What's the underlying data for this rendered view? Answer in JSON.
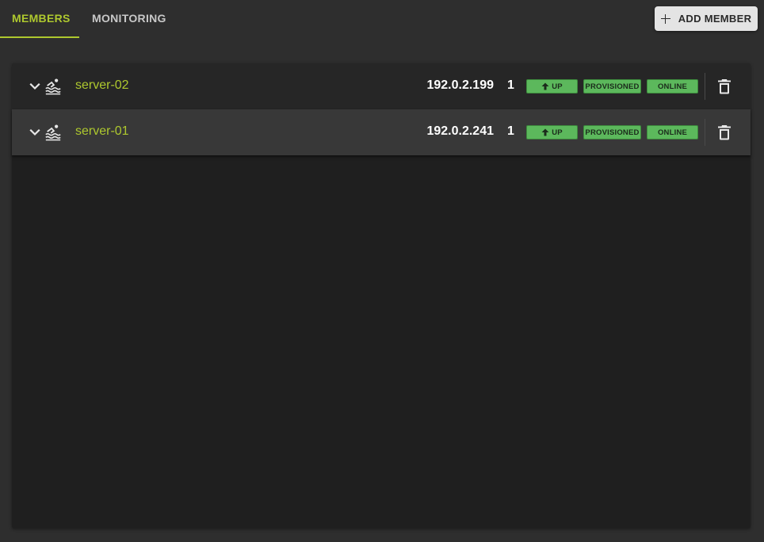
{
  "tabs": [
    {
      "label": "MEMBERS",
      "active": true
    },
    {
      "label": "MONITORING",
      "active": false
    }
  ],
  "add_button": {
    "label": "ADD MEMBER",
    "icon": "plus-icon"
  },
  "members": [
    {
      "name": "server-02",
      "ip": "192.0.2.199",
      "count": "1",
      "status_up": "UP",
      "status_provisioned": "PROVISIONED",
      "status_online": "ONLINE"
    },
    {
      "name": "server-01",
      "ip": "192.0.2.241",
      "count": "1",
      "status_up": "UP",
      "status_provisioned": "PROVISIONED",
      "status_online": "ONLINE"
    }
  ],
  "colors": {
    "accent": "#aec82e",
    "badge_green": "#5cb85c",
    "background": "#2e2e2e",
    "panel": "#1f1f1f"
  },
  "icons": {
    "expand": "chevron-down-icon",
    "member": "pool-icon",
    "status_up": "arrow-up-icon",
    "delete": "trash-icon"
  }
}
